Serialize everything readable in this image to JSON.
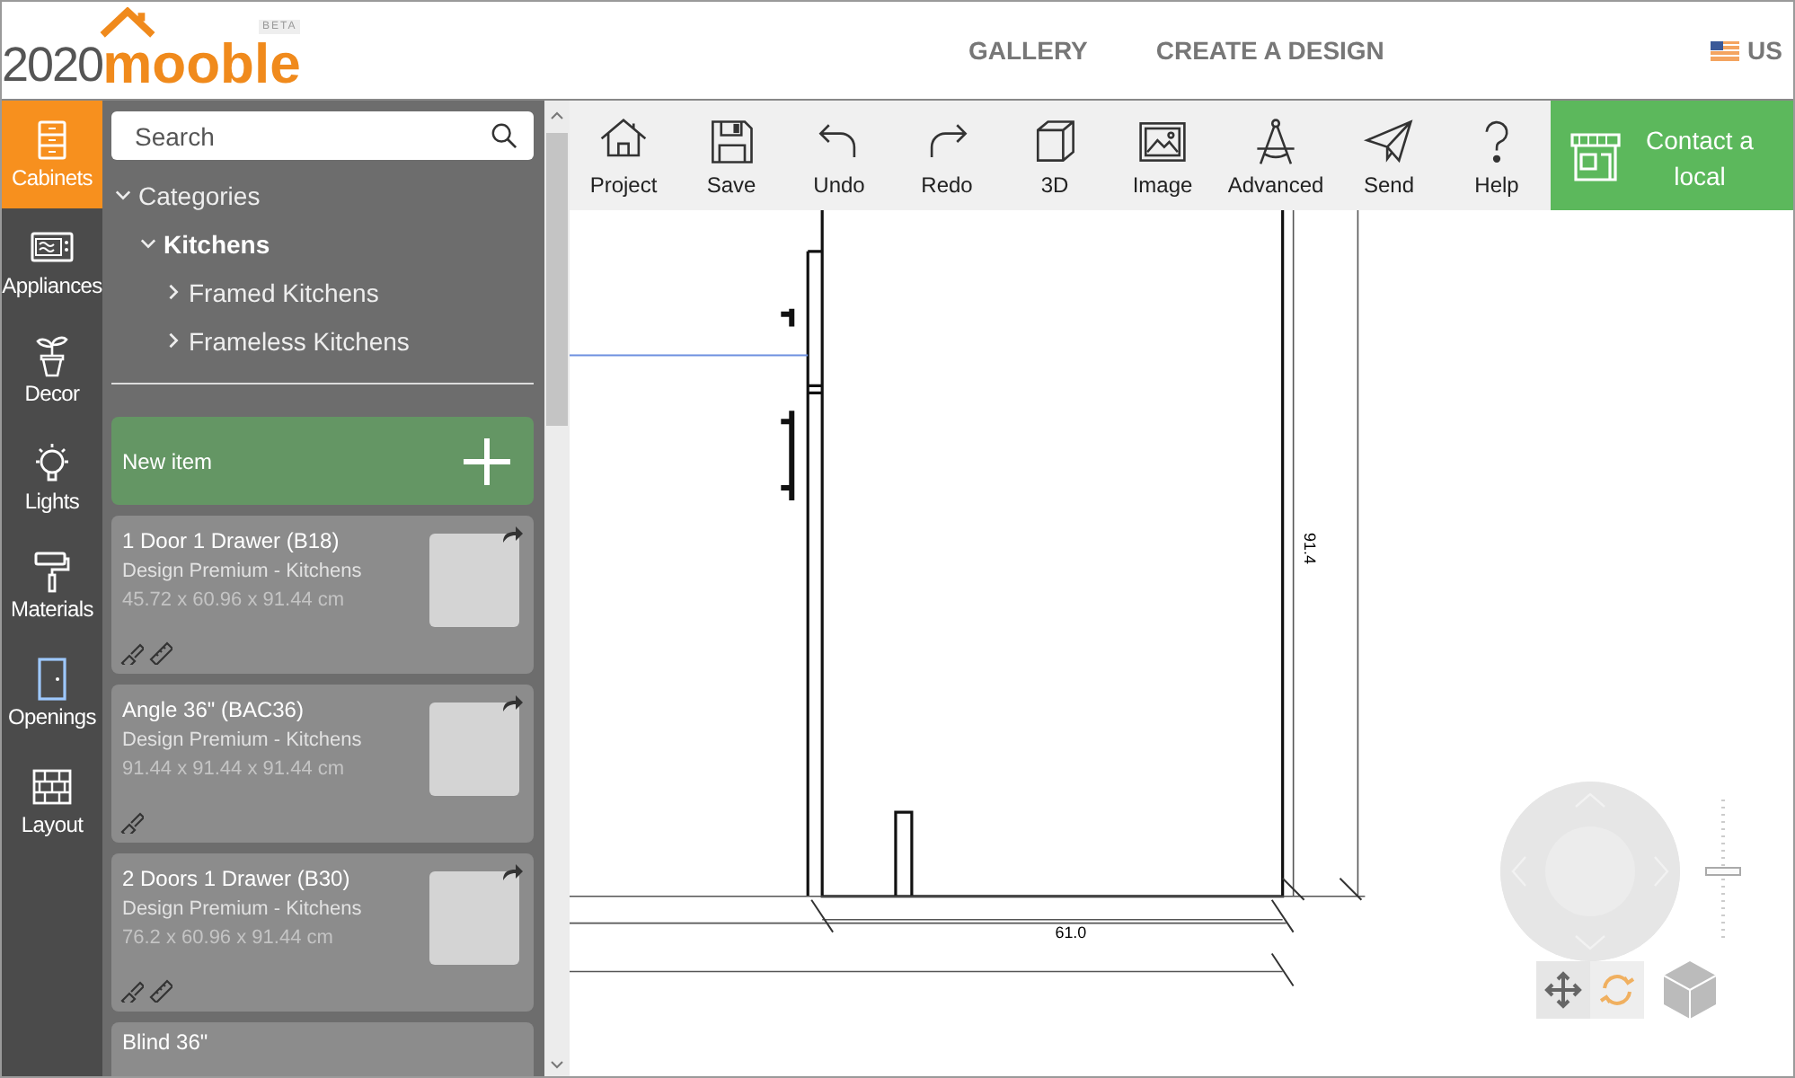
{
  "header": {
    "logo": {
      "prefix": "2020",
      "name": "mooble",
      "badge": "BETA"
    },
    "nav": [
      {
        "label": "GALLERY"
      },
      {
        "label": "CREATE A DESIGN"
      }
    ],
    "locale": {
      "label": "US"
    }
  },
  "rail": [
    {
      "label": "Cabinets",
      "selected": true
    },
    {
      "label": "Appliances",
      "selected": false
    },
    {
      "label": "Decor",
      "selected": false
    },
    {
      "label": "Lights",
      "selected": false
    },
    {
      "label": "Materials",
      "selected": false
    },
    {
      "label": "Openings",
      "selected": false
    },
    {
      "label": "Layout",
      "selected": false
    }
  ],
  "catalog": {
    "search": {
      "placeholder": "Search"
    },
    "tree": [
      {
        "label": "Categories",
        "expanded": true,
        "children": [
          {
            "label": "Kitchens",
            "expanded": true,
            "children": [
              {
                "label": "Framed Kitchens",
                "expanded": false
              },
              {
                "label": "Frameless Kitchens",
                "expanded": false
              }
            ]
          }
        ]
      }
    ],
    "new_item": {
      "label": "New item"
    },
    "items": [
      {
        "title": "1 Door 1 Drawer (B18)",
        "brand": "Design Premium - Kitchens",
        "size": "45.72 x 60.96 x 91.44 cm",
        "resizable": true
      },
      {
        "title": "Angle 36\" (BAC36)",
        "brand": "Design Premium - Kitchens",
        "size": "91.44 x 91.44 x 91.44 cm",
        "resizable": false
      },
      {
        "title": "2 Doors 1 Drawer (B30)",
        "brand": "Design Premium - Kitchens",
        "size": "76.2 x 60.96 x 91.44 cm",
        "resizable": true
      },
      {
        "title": "Blind 36\""
      }
    ]
  },
  "toolbar": [
    {
      "label": "Project"
    },
    {
      "label": "Save"
    },
    {
      "label": "Undo"
    },
    {
      "label": "Redo"
    },
    {
      "label": "3D"
    },
    {
      "label": "Image"
    },
    {
      "label": "Advanced"
    },
    {
      "label": "Send"
    },
    {
      "label": "Help"
    }
  ],
  "contact_button": {
    "label": "Contact a local"
  },
  "drawing": {
    "width_dimension": "61.0",
    "height_dimension": "91.4"
  },
  "zoom_slider": {
    "level": 0.5
  }
}
